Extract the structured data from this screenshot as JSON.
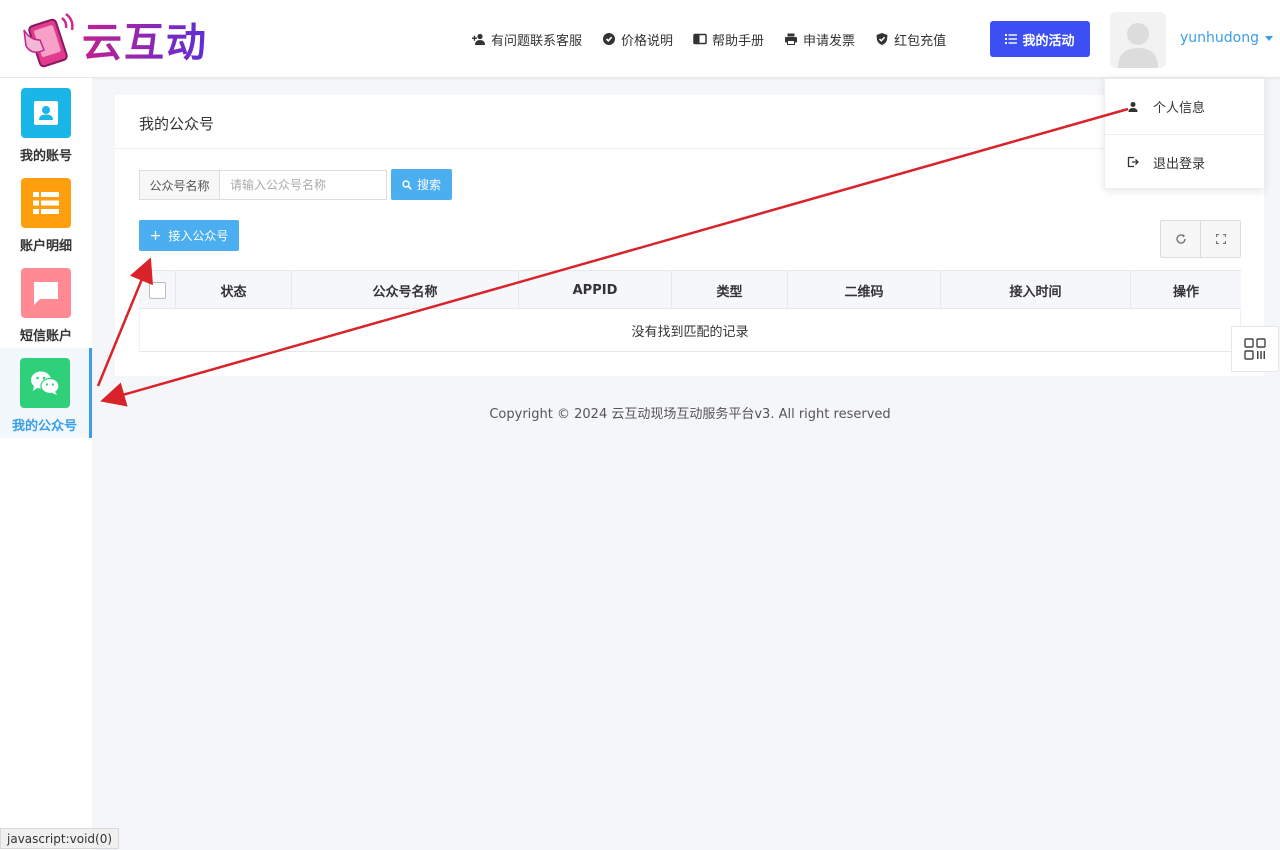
{
  "brand": {
    "name": "云互动"
  },
  "header": {
    "nav": [
      {
        "label": "有问题联系客服",
        "icon": "user-plus-icon"
      },
      {
        "label": "价格说明",
        "icon": "badge-icon"
      },
      {
        "label": "帮助手册",
        "icon": "book-icon"
      },
      {
        "label": "申请发票",
        "icon": "printer-icon"
      },
      {
        "label": "红包充值",
        "icon": "shield-check-icon"
      }
    ],
    "activity_button": "我的活动",
    "username": "yunhudong"
  },
  "user_menu": {
    "items": [
      {
        "label": "个人信息",
        "icon": "user-icon"
      },
      {
        "label": "退出登录",
        "icon": "logout-icon"
      }
    ]
  },
  "sidebar": {
    "items": [
      {
        "label": "我的账号",
        "icon": "account-card-icon",
        "color": "#1ab6e8"
      },
      {
        "label": "账户明细",
        "icon": "list-icon",
        "color": "#ff9f0e"
      },
      {
        "label": "短信账户",
        "icon": "message-icon",
        "color": "#ff8a93"
      },
      {
        "label": "我的公众号",
        "icon": "wechat-icon",
        "color": "#2fd07a",
        "active": true
      }
    ]
  },
  "main": {
    "title": "我的公众号",
    "search": {
      "label": "公众号名称",
      "placeholder": "请输入公众号名称",
      "value": "",
      "button": "搜索"
    },
    "add_button": "接入公众号",
    "table": {
      "columns": [
        "状态",
        "公众号名称",
        "APPID",
        "类型",
        "二维码",
        "接入时间",
        "操作"
      ],
      "empty_text": "没有找到匹配的记录"
    }
  },
  "footer": {
    "copyright": "Copyright © 2024 云互动现场互动服务平台v3. All right reserved"
  },
  "statusbar": {
    "text": "javascript:void(0)"
  },
  "colors": {
    "primary": "#4aaef0",
    "activity": "#3c4ff2",
    "link": "#3a9ee8",
    "annotation": "#d9232b"
  }
}
